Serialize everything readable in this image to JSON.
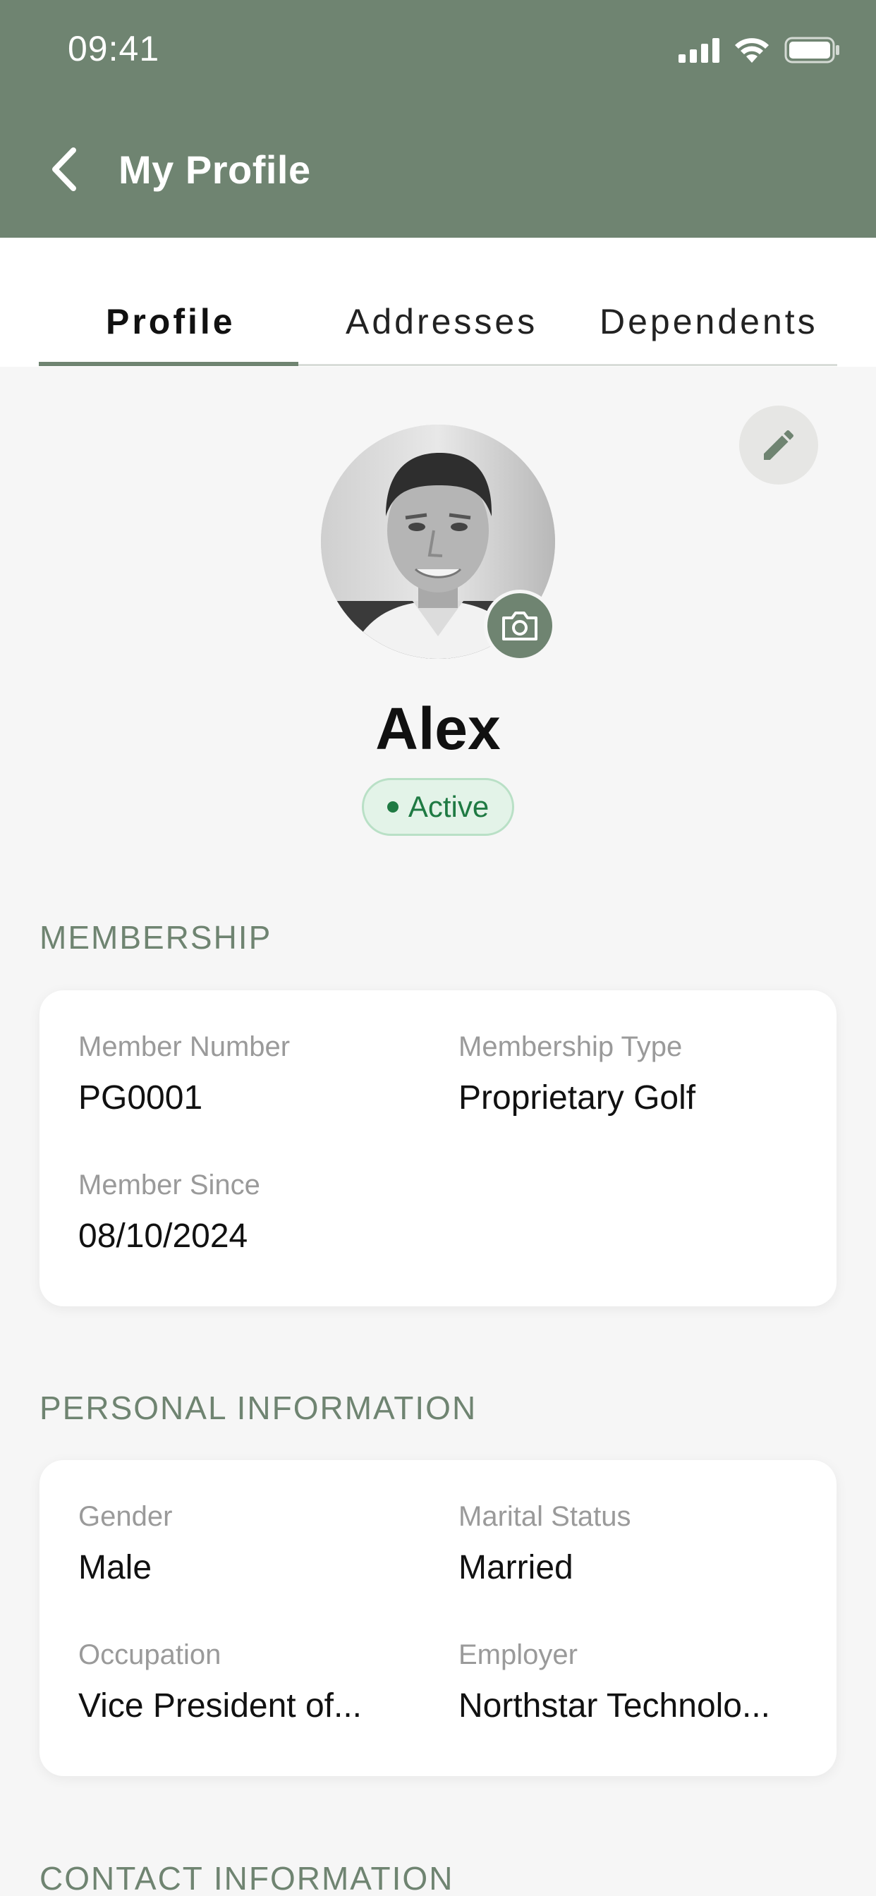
{
  "status_bar": {
    "time": "09:41"
  },
  "header": {
    "title": "My Profile"
  },
  "tabs": [
    {
      "label": "Profile",
      "active": true
    },
    {
      "label": "Addresses",
      "active": false
    },
    {
      "label": "Dependents",
      "active": false
    }
  ],
  "profile": {
    "name": "Alex",
    "status": "Active"
  },
  "membership": {
    "section_title": "MEMBERSHIP",
    "fields": [
      {
        "label": "Member Number",
        "value": "PG0001"
      },
      {
        "label": "Membership Type",
        "value": "Proprietary Golf"
      },
      {
        "label": "Member Since",
        "value": "08/10/2024"
      }
    ]
  },
  "personal": {
    "section_title": "PERSONAL INFORMATION",
    "fields": [
      {
        "label": "Gender",
        "value": "Male"
      },
      {
        "label": "Marital Status",
        "value": "Married"
      },
      {
        "label": "Occupation",
        "value": "Vice President of..."
      },
      {
        "label": "Employer",
        "value": "Northstar Technolo..."
      }
    ]
  },
  "contact": {
    "section_title": "CONTACT INFORMATION"
  },
  "colors": {
    "brand": "#6f8471",
    "status_active": "#1f7a43",
    "status_active_bg": "#e3f3e8"
  },
  "icons": [
    "back-chevron-icon",
    "signal-icon",
    "wifi-icon",
    "battery-icon",
    "pencil-icon",
    "camera-icon"
  ]
}
